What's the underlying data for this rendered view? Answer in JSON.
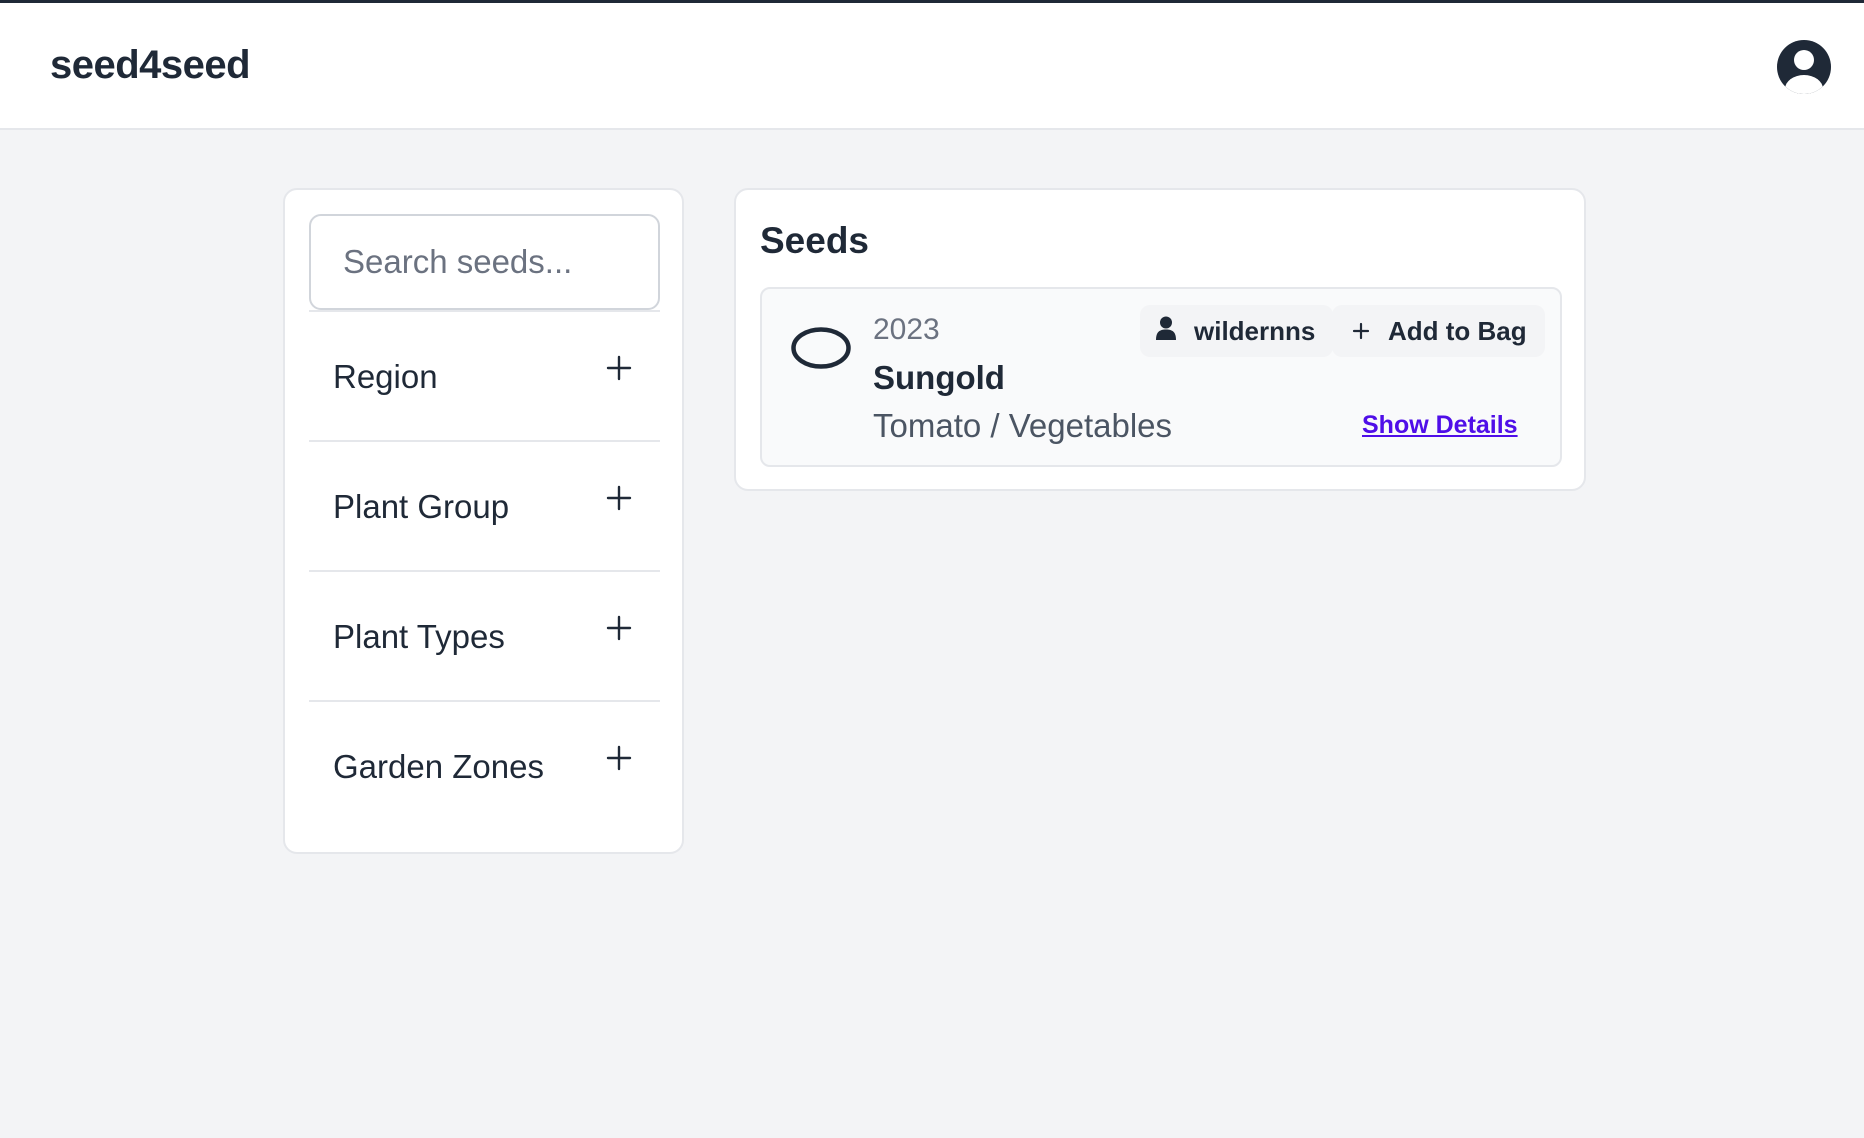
{
  "header": {
    "brand": "seed4seed",
    "account_icon": "user-circle-icon"
  },
  "sidebar": {
    "search": {
      "placeholder": "Search seeds...",
      "value": ""
    },
    "filters": [
      {
        "label": "Region",
        "icon": "plus-icon"
      },
      {
        "label": "Plant Group",
        "icon": "plus-icon"
      },
      {
        "label": "Plant Types",
        "icon": "plus-icon"
      },
      {
        "label": "Garden Zones",
        "icon": "plus-icon"
      }
    ]
  },
  "main": {
    "title": "Seeds",
    "seeds": [
      {
        "icon": "seed-oval-icon",
        "year": "2023",
        "name": "Sungold",
        "type": "Tomato / Vegetables",
        "owner": "wildernns",
        "owner_icon": "user-icon",
        "add_label": "Add to Bag",
        "add_icon": "plus-icon",
        "details_label": "Show Details"
      }
    ]
  },
  "colors": {
    "background": "#f3f4f6",
    "text": "#1f2937",
    "link": "#4f0ee8",
    "border": "#e5e7eb"
  }
}
